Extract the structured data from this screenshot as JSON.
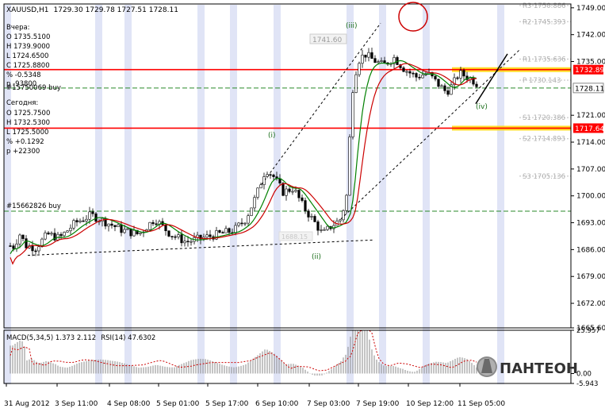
{
  "header": {
    "symbol": "XAUUSD,H1",
    "ohlc": "1729.30 1729.78 1727.51 1728.11"
  },
  "yesterday": {
    "title": "Вчера:",
    "open": "O 1735.5100",
    "high": "H 1739.9000",
    "low": "L 1724.6500",
    "close": "C 1725.8800",
    "pct": "% -0.5348",
    "pts": "p -93800"
  },
  "today": {
    "title": "Сегодня:",
    "open": "O 1725.7500",
    "high": "H 1732.5300",
    "low": "L 1725.5000",
    "pct": "% +0.1292",
    "pts": "p +22300"
  },
  "orders": [
    {
      "label": "#15750069 buy"
    },
    {
      "label": "#15662826 buy"
    }
  ],
  "waves": [
    "(i)",
    "(ii)",
    "(iii)",
    "(iv)"
  ],
  "logo": "ПАНТЕОН",
  "main_chart": {
    "type": "candlestick",
    "symbol": "XAUUSD",
    "timeframe": "H1",
    "ylim": [
      1665.6,
      1750.0
    ],
    "y_ticks": [
      "1749.00",
      "1742.00",
      "1735.00",
      "1728.11",
      "1721.00",
      "1714.00",
      "1707.00",
      "1700.00",
      "1693.00",
      "1686.00",
      "1679.00",
      "1672.00",
      "1665.60"
    ],
    "x_ticks": [
      "31 Aug 2012",
      "3 Sep 11:00",
      "4 Sep 08:00",
      "5 Sep 01:00",
      "5 Sep 17:00",
      "6 Sep 10:00",
      "7 Sep 03:00",
      "7 Sep 19:00",
      "10 Sep 12:00",
      "11 Sep 05:00"
    ],
    "current_price": "1728.11",
    "horizontal_levels": [
      {
        "label": "R3 1750.886",
        "value": 1750.886,
        "color": "#cccccc"
      },
      {
        "label": "R2 1745.393",
        "value": 1745.393,
        "color": "#cccccc"
      },
      {
        "label": "R1 1735.636",
        "value": 1735.636,
        "color": "#cccccc"
      },
      {
        "label": "P 1730.143",
        "value": 1730.143,
        "color": "#cccccc"
      },
      {
        "label": "S1 1720.386",
        "value": 1720.386,
        "color": "#cccccc"
      },
      {
        "label": "S2 1714.893",
        "value": 1714.893,
        "color": "#cccccc"
      },
      {
        "label": "S3 1705.136",
        "value": 1705.136,
        "color": "#cccccc"
      }
    ],
    "resistance": {
      "label": "1732.89",
      "value": 1732.89,
      "color": "#ff0000"
    },
    "support": {
      "label": "1717.64",
      "value": 1717.64,
      "color": "#ff0000"
    },
    "peak_label": "1741.60",
    "low_label": "1688.15",
    "green_level": 1728.11,
    "green_level_2": 1696.0
  },
  "macd": {
    "label": "MACD(5,34,5) 1.373 2.112",
    "y_ticks": [
      "25.957",
      "0.00",
      "-5.943"
    ],
    "ylim": [
      -5.943,
      25.957
    ]
  },
  "rsi": {
    "label": "RSI(14) 47.6302"
  },
  "colors": {
    "red_line": "#ff0000",
    "green_ma": "#008000",
    "red_ma": "#cc0000",
    "highlight": "#ffd800",
    "session": "#e0e4f6",
    "dashed_green": "#2a8a2a"
  }
}
